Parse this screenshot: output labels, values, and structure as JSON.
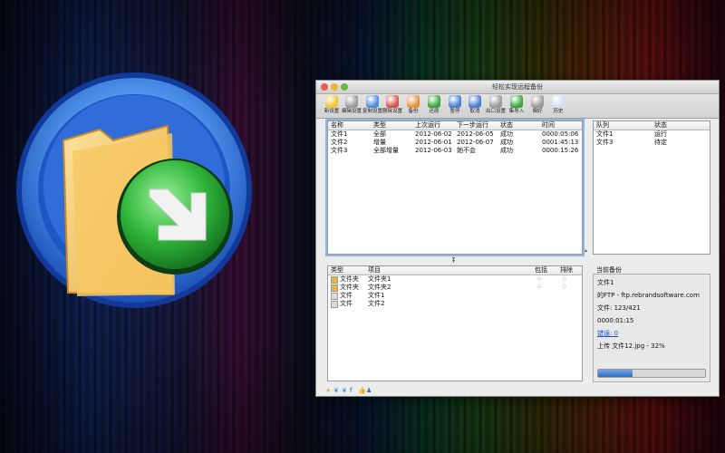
{
  "window": {
    "title": "轻松实现远程备份"
  },
  "toolbar": {
    "buttons": [
      {
        "label": "新设置",
        "icon": "new-setting-icon",
        "color": "#f1c232"
      },
      {
        "label": "编辑设置",
        "icon": "edit-setting-icon",
        "color": "#9a9a9a"
      },
      {
        "label": "复制设置",
        "icon": "copy-setting-icon",
        "color": "#4a90d9"
      },
      {
        "label": "删除设置",
        "icon": "delete-setting-icon",
        "color": "#d9534f"
      },
      {
        "label": "备份",
        "icon": "backup-icon",
        "color": "#e69138"
      },
      {
        "label": "还原",
        "icon": "restore-icon",
        "color": "#38a838"
      },
      {
        "label": "暂停",
        "icon": "pause-icon",
        "color": "#4a7fd0"
      },
      {
        "label": "取消",
        "icon": "cancel-icon",
        "color": "#4a7fd0"
      },
      {
        "label": "出口设置",
        "icon": "export-setting-icon",
        "color": "#9a9a9a"
      },
      {
        "label": "集导入",
        "icon": "import-icon",
        "color": "#38a838"
      },
      {
        "label": "偏好",
        "icon": "preferences-icon",
        "color": "#9a9a9a"
      },
      {
        "label": "历史",
        "icon": "history-icon",
        "color": "#cfe0f2"
      }
    ]
  },
  "backups_table": {
    "headers": [
      "名称",
      "类型",
      "上次运行",
      "下一步运行",
      "状态",
      "时间"
    ],
    "rows": [
      [
        "文件1",
        "全部",
        "2012-06-02",
        "2012-06-05",
        "成功",
        "0000:05:06"
      ],
      [
        "文件2",
        "增量",
        "2012-06-01",
        "2012-06-07",
        "成功",
        "0001:45:13"
      ],
      [
        "文件3",
        "全部增量",
        "2012-06-03",
        "她不会",
        "成功",
        "0000:15:26"
      ]
    ]
  },
  "queue_table": {
    "headers": [
      "队列",
      "状态"
    ],
    "rows": [
      [
        "文件1",
        "运行"
      ],
      [
        "文件3",
        "待定"
      ]
    ]
  },
  "items_table": {
    "headers": [
      "类型",
      "项目",
      "包括",
      "排除"
    ],
    "rows": [
      {
        "type": "文件夹",
        "item": "文件夹1",
        "kind": "folder"
      },
      {
        "type": "文件夹",
        "item": "文件夹2",
        "kind": "folder"
      },
      {
        "type": "文件",
        "item": "文件1",
        "kind": "file"
      },
      {
        "type": "文件",
        "item": "文件2",
        "kind": "file"
      }
    ]
  },
  "current_backup": {
    "title": "当前备份",
    "name": "文件1",
    "server": "的FTP - ftp.rebrandsoftware.com",
    "files": "文件: 123/421",
    "elapsed": "0000:01:15",
    "errors_link": "错误: 0",
    "uploading": "上传 文件12.jpg - 32%",
    "progress": 0.32
  },
  "bottom_icons": [
    "star-icon",
    "twitter-icon",
    "twitter-icon",
    "facebook-icon",
    "thumbs-up-icon",
    "users-icon"
  ],
  "colors": {
    "accent": "#2f6fc3",
    "link": "#1a4fd0",
    "icon_ring": "#2a6ad8",
    "arrow_green": "#2ea83a"
  }
}
